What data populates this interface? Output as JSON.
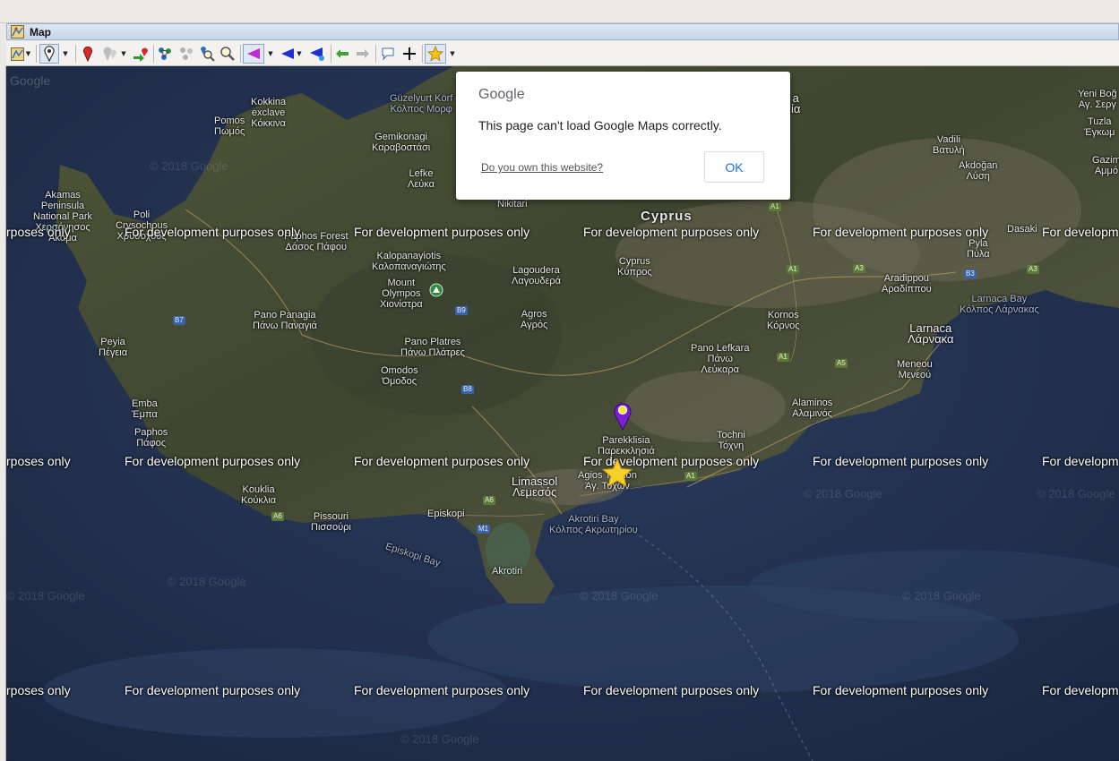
{
  "window": {
    "title": "Map"
  },
  "toolbar": {
    "buttons": [
      {
        "name": "map-type-button",
        "icon": "map-type-icon"
      },
      {
        "name": "marker-tool-button",
        "icon": "pin-icon",
        "selected": true
      },
      {
        "name": "red-marker-button",
        "icon": "red-pin-icon"
      },
      {
        "name": "hide-markers-button",
        "icon": "faded-pins-icon"
      },
      {
        "name": "route-marker-button",
        "icon": "green-arrow-pin-icon"
      },
      {
        "name": "cluster-button",
        "icon": "cluster-icon"
      },
      {
        "name": "cluster-faded-button",
        "icon": "cluster-faded-icon"
      },
      {
        "name": "find-markers-button",
        "icon": "magnify-pins-icon"
      },
      {
        "name": "zoom-button",
        "icon": "magnifier-icon"
      },
      {
        "name": "purple-arrow-button",
        "icon": "purple-arrow-icon"
      },
      {
        "name": "blue-arrow-button",
        "icon": "blue-arrow-icon"
      },
      {
        "name": "blue-arrow-alt-button",
        "icon": "blue-arrow-alt-icon"
      },
      {
        "name": "back-button",
        "icon": "green-left-arrow-icon"
      },
      {
        "name": "forward-button",
        "icon": "grey-right-arrow-icon"
      },
      {
        "name": "annotation-button",
        "icon": "speech-bubble-icon"
      },
      {
        "name": "crosshair-button",
        "icon": "plus-icon"
      },
      {
        "name": "favorite-button",
        "icon": "star-icon"
      }
    ]
  },
  "dialog": {
    "brand": "Google",
    "message": "This page can't load Google Maps correctly.",
    "link": "Do you own this website?",
    "ok": "OK"
  },
  "map": {
    "google_logo": "Google",
    "watermark": "For development purposes only",
    "watermark_clipped_left": "rposes only",
    "watermark_clipped_right": "For developm",
    "copyright": "© 2018 Google",
    "marker_place": "Parekklisia",
    "labels": {
      "kokkina": [
        "Kokkina",
        "exclave",
        "Κόκκινα"
      ],
      "pomos": [
        "Pomos",
        "Πωμός"
      ],
      "guzelyurt": [
        "Güzelyurt Körf",
        "Κόλπος Μορφ"
      ],
      "gemikonagi": [
        "Gemikonagi",
        "Καραβοστάσι"
      ],
      "lefke": [
        "Lefke",
        "Λεύκα"
      ],
      "akamas": [
        "Akamas",
        "Peninsula",
        "National Park",
        "Χερσόνησος",
        "Ακάμα"
      ],
      "poli": [
        "Poli",
        "Crysochous",
        "Χρυσοχούς"
      ],
      "paphos_forest": [
        "Paphos Forest",
        "Δάσος Πάφου"
      ],
      "nikitari": [
        "Nikitari"
      ],
      "cyprus_big": [
        "Cyprus"
      ],
      "kalopanayiotis": [
        "Kalopanayiotis",
        "Καλοπαναγιώτης"
      ],
      "mount_olympos": [
        "Mount",
        "Olympos",
        "Χιονίστρα"
      ],
      "lagoudera": [
        "Lagoudera",
        "Λαγουδερά"
      ],
      "cyprus_small": [
        "Cyprus",
        "Κύπρος"
      ],
      "pano_panagia": [
        "Pano Panagia",
        "Πάνω Παναγιά"
      ],
      "agros": [
        "Agros",
        "Αγρός"
      ],
      "peyia": [
        "Peyia",
        "Πέγεια"
      ],
      "pano_platres": [
        "Pano Platres",
        "Πάνω Πλάτρες"
      ],
      "omodos": [
        "Omodos",
        "Όμοδος"
      ],
      "pano_lefkara": [
        "Pano Lefkara",
        "Πάνω",
        "Λεύκαρα"
      ],
      "kornos": [
        "Kornos",
        "Κόρνος"
      ],
      "emba": [
        "Emba",
        "Έμπα"
      ],
      "paphos": [
        "Paphos",
        "Πάφος"
      ],
      "parekklisia": [
        "Parekklisia",
        "Παρεκκλησιά"
      ],
      "agios_tychon": [
        "Agios Tychon",
        "Άγ. Τύχων"
      ],
      "limassol": [
        "Limassol",
        "Λεμεσός"
      ],
      "tochni": [
        "Tochni",
        "Τόχνη"
      ],
      "alaminos": [
        "Alaminos",
        "Αλαμινός"
      ],
      "koukila": [
        "Kouklia",
        "Κούκλια"
      ],
      "pissouri": [
        "Pissouri",
        "Πισσούρι"
      ],
      "episkopi": [
        "Episkopi"
      ],
      "akrotiri_bay": [
        "Akrotiri Bay",
        "Κόλπος Ακρωτηρίου"
      ],
      "episkopi_bay": [
        "Episkopi Bay"
      ],
      "akrotiri": [
        "Akrotiri"
      ],
      "vadili": [
        "Vadili",
        "Βατυλή"
      ],
      "akdogan": [
        "Akdoğan",
        "Λύση"
      ],
      "aradippou": [
        "Aradippou",
        "Αραδίππου"
      ],
      "larnaca": [
        "Larnaca",
        "Λάρνακα"
      ],
      "larnaca_bay": [
        "Larnaca Bay",
        "Κόλπος Λάρνακας"
      ],
      "meneou": [
        "Meneou",
        "Μενεού"
      ],
      "pyla": [
        "Pyla",
        "Πύλα"
      ],
      "dasaki": [
        "Dasaki"
      ],
      "yeni_bog": [
        "Yeni Boğ",
        "Αγ. Σεργ"
      ],
      "tuzla": [
        "Tuzla",
        "Έγκωμ"
      ],
      "gazim": [
        "Gazim",
        "Αμμό"
      ],
      "nicosia_frag": [
        "a",
        "ία"
      ]
    },
    "road_numbers": {
      "b7": "B7",
      "b9": "B9",
      "b8": "B8",
      "a1a": "A1",
      "a1b": "A1",
      "a1c": "A1",
      "a1d": "A1",
      "a6a": "A6",
      "a6b": "A6",
      "m1": "M1",
      "a5": "A5",
      "a3a": "A3",
      "a3b": "A3",
      "b3": "B3"
    }
  }
}
